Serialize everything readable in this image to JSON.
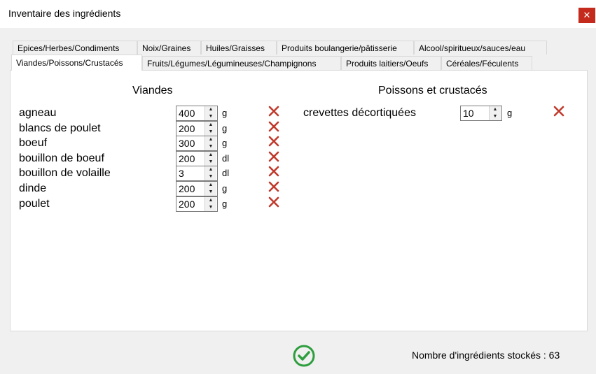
{
  "window": {
    "title": "Inventaire des ingrédients",
    "close_glyph": "✕"
  },
  "tabs_row1": [
    "Epices/Herbes/Condiments",
    "Noix/Graines",
    "Huiles/Graisses",
    "Produits boulangerie/pâtisserie",
    "Alcool/spiritueux/sauces/eau"
  ],
  "tabs_row2": [
    "Viandes/Poissons/Crustacés",
    "Fruits/Légumes/Légumineuses/Champignons",
    "Produits laitiers/Oeufs",
    "Céréales/Féculents"
  ],
  "active_tab": "Viandes/Poissons/Crustacés",
  "viandes": {
    "title": "Viandes",
    "items": [
      {
        "name": "agneau",
        "value": "400",
        "unit": "g"
      },
      {
        "name": "blancs de poulet",
        "value": "200",
        "unit": "g"
      },
      {
        "name": "boeuf",
        "value": "300",
        "unit": "g"
      },
      {
        "name": "bouillon de boeuf",
        "value": "200",
        "unit": "dl"
      },
      {
        "name": "bouillon de volaille",
        "value": "3",
        "unit": "dl"
      },
      {
        "name": "dinde",
        "value": "200",
        "unit": "g"
      },
      {
        "name": "poulet",
        "value": "200",
        "unit": "g"
      }
    ]
  },
  "poissons": {
    "title": "Poissons et crustacés",
    "items": [
      {
        "name": "crevettes décortiquées",
        "value": "10",
        "unit": "g"
      }
    ]
  },
  "icons": {
    "delete": "close-x-icon",
    "ok": "check-circle-icon",
    "delete_color": "#c0392b",
    "ok_color": "#2e9e3e"
  },
  "status": {
    "count_text": "Nombre d'ingrédients stockés : 63"
  }
}
